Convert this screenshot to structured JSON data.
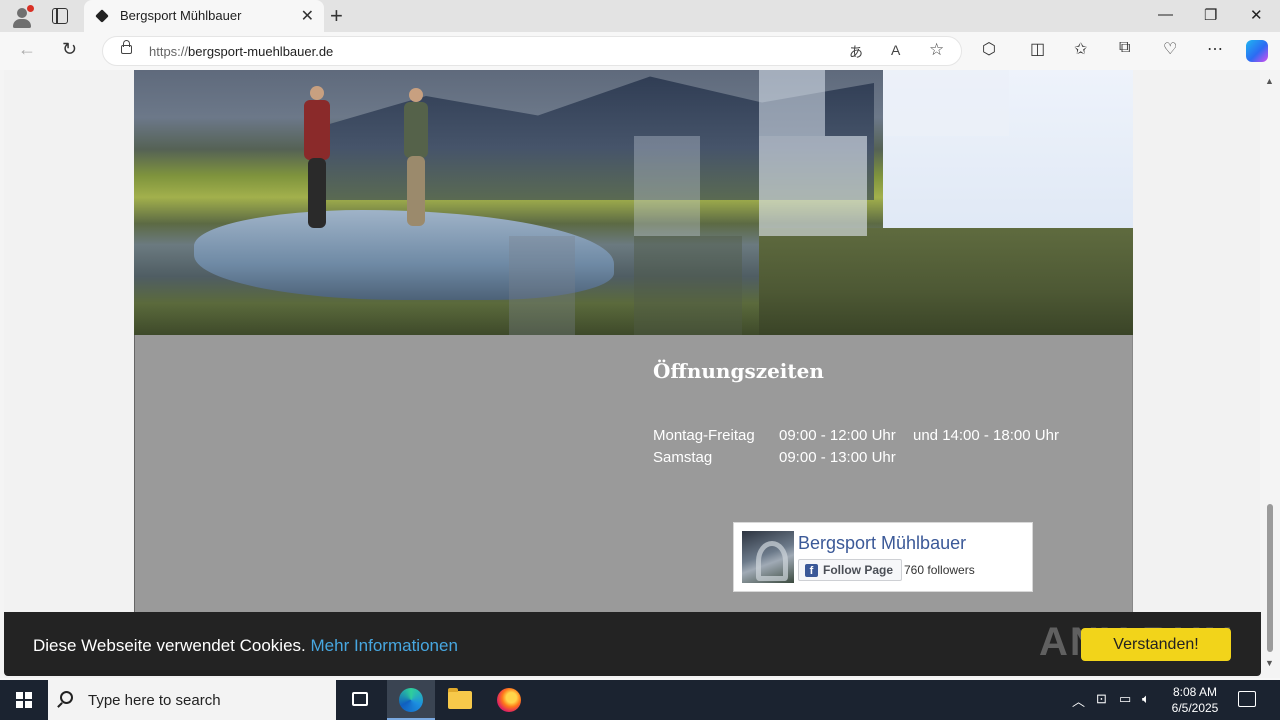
{
  "browser": {
    "tab_title": "Bergsport Mühlbauer",
    "url_protocol": "https://",
    "url_domain": "bergsport-muehlbauer.de",
    "new_tab_symbol": "+",
    "close_tab_symbol": "✕",
    "minimize_symbol": "—",
    "restore_symbol": "❐",
    "close_window_symbol": "✕"
  },
  "hours": {
    "title": "Öffnungszeiten",
    "rows": [
      {
        "day": "Montag-Freitag",
        "time": "09:00 - 12:00 Uhr",
        "extra": "und 14:00 - 18:00 Uhr"
      },
      {
        "day": "Samstag",
        "time": "09:00 - 13:00 Uhr",
        "extra": ""
      }
    ]
  },
  "facebook": {
    "page_name": "Bergsport Mühlbauer",
    "follow_label": "Follow Page",
    "followers": "760 followers"
  },
  "cookie": {
    "text": "Diese Webseite verwendet Cookies.",
    "link": "Mehr Informationen",
    "button": "Verstanden!",
    "watermark": "ANY RUN"
  },
  "taskbar": {
    "search_placeholder": "Type here to search",
    "time": "8:08 AM",
    "date": "6/5/2025"
  },
  "colors": {
    "accent_link": "#47a7e0",
    "cookie_button": "#f2d41a",
    "facebook_blue": "#3b5998",
    "section_gray": "#9a9a9a"
  }
}
